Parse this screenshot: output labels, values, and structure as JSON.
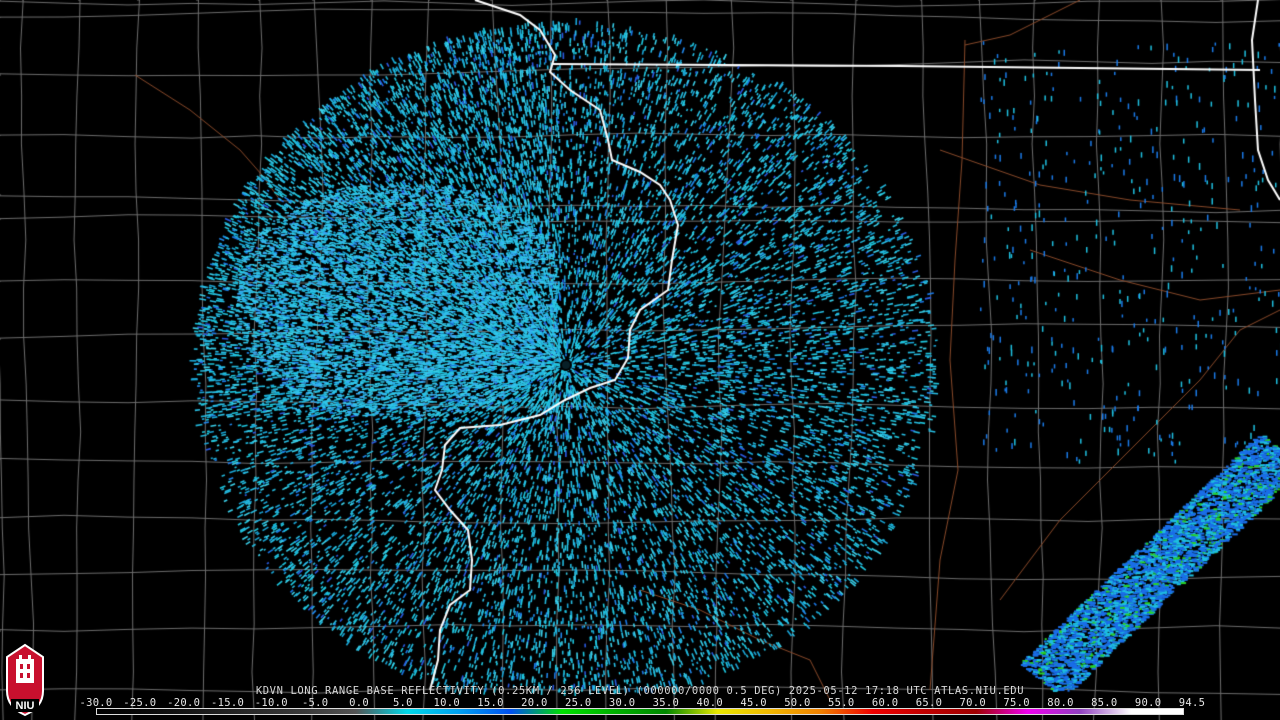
{
  "caption": "KDVN LONG RANGE BASE REFLECTIVITY (0.25KM / 256 LEVEL) (000000/0000 0.5 DEG) 2025-05-12 17:18 UTC  ATLAS.NIU.EDU",
  "colorbar": {
    "ticks": [
      "-30.0",
      "-25.0",
      "-20.0",
      "-15.0",
      "-10.0",
      "-5.0",
      "0.0",
      "5.0",
      "10.0",
      "15.0",
      "20.0",
      "25.0",
      "30.0",
      "35.0",
      "40.0",
      "45.0",
      "50.0",
      "55.0",
      "60.0",
      "65.0",
      "70.0",
      "75.0",
      "80.0",
      "85.0",
      "90.0",
      "94.5"
    ],
    "stops": [
      "#000000",
      "#0a0a0a",
      "#1a1a1a",
      "#2a2a2a",
      "#3a3a3a",
      "#555555",
      "#00d8e8",
      "#00a0f0",
      "#0050f0",
      "#00e000",
      "#00b000",
      "#008800",
      "#e8e800",
      "#f0b800",
      "#f08000",
      "#f00000",
      "#c00000",
      "#a00000",
      "#f000f0",
      "#9040c0",
      "#ffffff",
      "#ffffff"
    ]
  },
  "logo": {
    "text": "NIU",
    "color": "#c8102e"
  },
  "colors": {
    "background": "#000000",
    "county_lines": "#6e6e6e",
    "state_lines": "#ffffff",
    "rivers": "#8a4a2a",
    "echo_low": "#22c4e0",
    "echo_mid": "#1a6ee8",
    "echo_high": "#28d228"
  }
}
